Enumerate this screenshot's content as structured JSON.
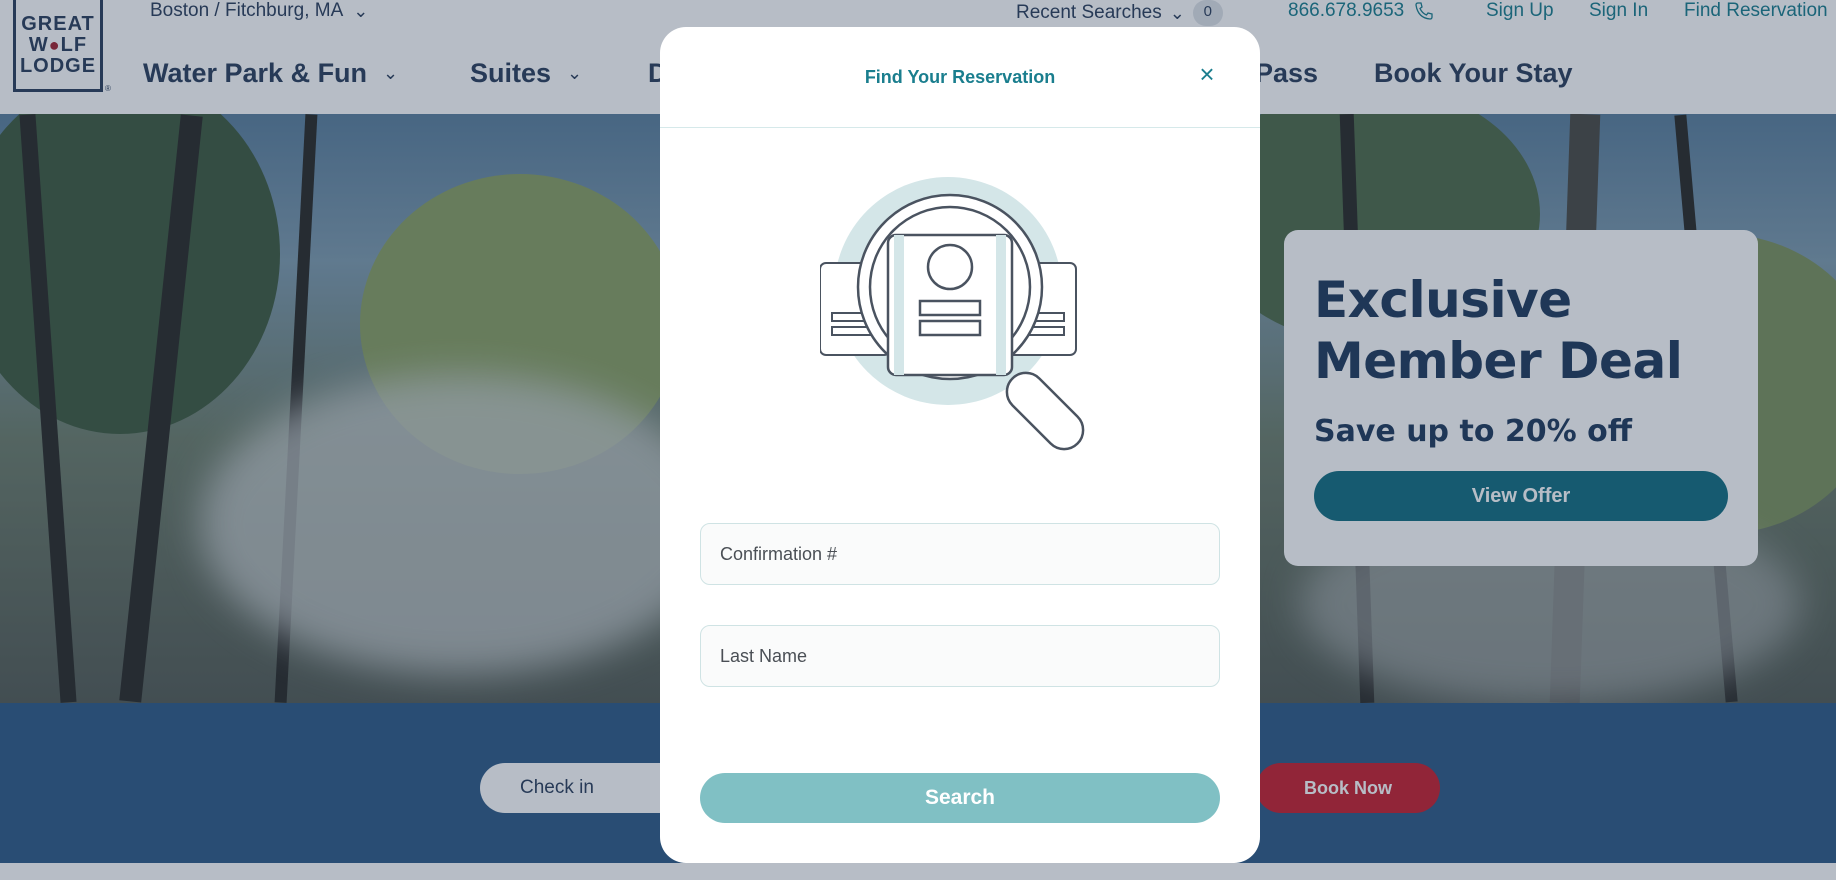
{
  "header": {
    "logo_lines": [
      "GREAT",
      "W",
      "LF",
      "LODGE"
    ],
    "logo_reg": "®",
    "location": "Boston / Fitchburg, MA",
    "recent_searches": "Recent Searches",
    "recent_count": "0",
    "phone": "866.678.9653",
    "sign_up": "Sign Up",
    "sign_in": "Sign In",
    "find_reservation": "Find Reservation",
    "nav": [
      {
        "label": "Water Park & Fun"
      },
      {
        "label": "Suites"
      },
      {
        "label": "D"
      },
      {
        "label": "Pass"
      },
      {
        "label": "Book Your Stay"
      }
    ]
  },
  "promo": {
    "title": "Exclusive Member Deal",
    "subtitle": "Save up to 20% off",
    "button": "View Offer"
  },
  "booking": {
    "check_in": "Check in",
    "book_now": "Book Now"
  },
  "modal": {
    "title": "Find Your Reservation",
    "close_symbol": "×",
    "confirmation_placeholder": "Confirmation #",
    "last_name_placeholder": "Last Name",
    "search_button": "Search"
  },
  "colors": {
    "brand_navy": "#2c3f5c",
    "teal": "#1a7e8e",
    "search_button": "#80c0c4",
    "book_now": "#c8202e",
    "view_offer": "#136e80"
  }
}
